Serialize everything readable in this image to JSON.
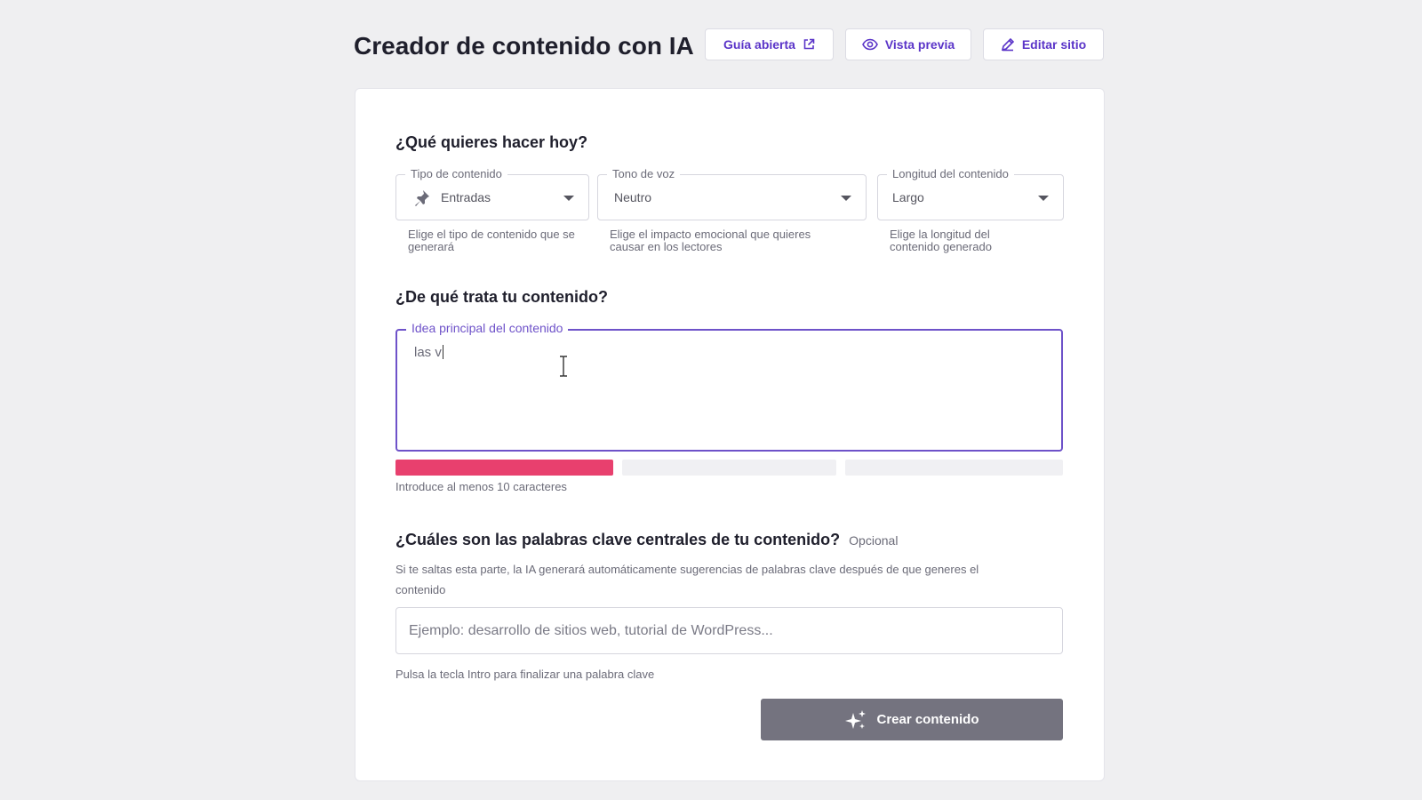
{
  "header": {
    "title": "Creador de contenido con IA",
    "buttons": {
      "guide": "Guía abierta",
      "preview": "Vista previa",
      "edit": "Editar sitio"
    }
  },
  "section1": {
    "title": "¿Qué quieres hacer hoy?",
    "content_type": {
      "label": "Tipo de contenido",
      "value": "Entradas",
      "icon": "pin-icon",
      "helper": "Elige el tipo de contenido que se generará"
    },
    "tone": {
      "label": "Tono de voz",
      "value": "Neutro",
      "helper": "Elige el impacto emocional que quieres causar en los lectores"
    },
    "length": {
      "label": "Longitud del contenido",
      "value": "Largo",
      "helper": "Elige la longitud del contenido generado"
    }
  },
  "section2": {
    "title": "¿De qué trata tu contenido?",
    "idea": {
      "label": "Idea principal del contenido",
      "value": "las v"
    },
    "strength_colors": [
      "#e8406e",
      "#f0f0f3",
      "#f0f0f3"
    ],
    "strength_filled": 1,
    "helper": "Introduce al menos 10 caracteres"
  },
  "section3": {
    "title": "¿Cuáles son las palabras clave centrales de tu contenido?",
    "optional": "Opcional",
    "description": "Si te saltas esta parte, la IA generará automáticamente sugerencias de palabras clave después de que generes el contenido",
    "placeholder": "Ejemplo: desarrollo de sitios web, tutorial de WordPress...",
    "helper": "Pulsa la tecla Intro para finalizar una palabra clave"
  },
  "actions": {
    "create": "Crear contenido"
  },
  "colors": {
    "accent": "#5a34c8",
    "focus": "#6e52c9",
    "button_disabled": "#74737f"
  }
}
